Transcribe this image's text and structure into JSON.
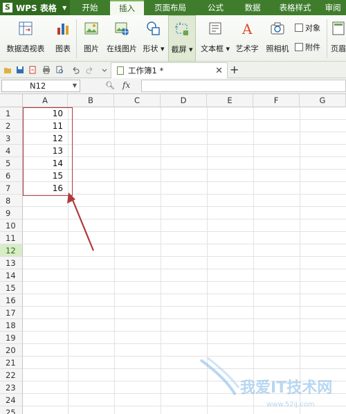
{
  "app": {
    "name": "WPS 表格"
  },
  "menu": {
    "tabs": [
      "开始",
      "插入",
      "页面布局",
      "公式",
      "数据",
      "表格样式",
      "审阅"
    ],
    "active": "插入"
  },
  "ribbon": {
    "buttons": [
      "数据透视表",
      "图表",
      "图片",
      "在线图片",
      "形状",
      "截屏",
      "文本框",
      "艺术字",
      "照相机",
      "页眉"
    ],
    "small": [
      "对象",
      "附件"
    ]
  },
  "doc_tab": {
    "title": "工作簿1 *"
  },
  "formula_bar": {
    "name_box": "N12",
    "fx": "fx",
    "value": ""
  },
  "sheet": {
    "columns": [
      "A",
      "B",
      "C",
      "D",
      "E",
      "F",
      "G"
    ],
    "rows": [
      "1",
      "2",
      "3",
      "4",
      "5",
      "6",
      "7",
      "8",
      "9",
      "10",
      "11",
      "12",
      "13",
      "14",
      "15",
      "16",
      "17",
      "18",
      "19",
      "20",
      "21",
      "22",
      "23",
      "24",
      "25"
    ],
    "active_row": "12",
    "cells_A": [
      "10",
      "11",
      "12",
      "13",
      "14",
      "15",
      "16"
    ]
  },
  "watermark": {
    "text": "我爱IT技术网",
    "url": "www.52ij.com"
  },
  "colors": {
    "accent": "#3f7d2c",
    "highlight_box": "#b03a3a",
    "active_row_header": "#d8ecc6"
  }
}
